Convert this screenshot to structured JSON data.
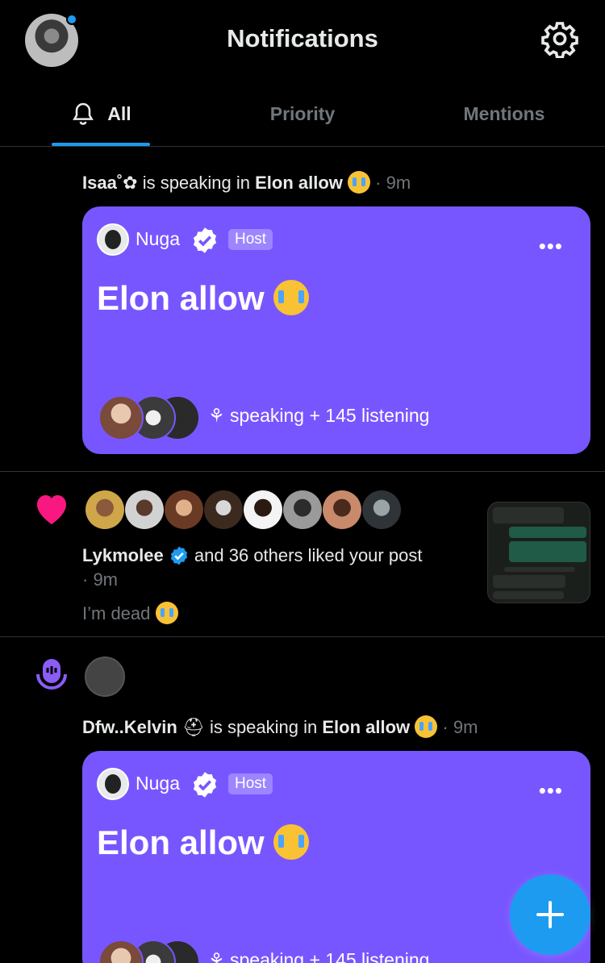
{
  "header": {
    "title": "Notifications",
    "settings_icon": "gear-icon",
    "avatar_has_badge": true
  },
  "tabs": [
    {
      "label": "All",
      "icon": "bell-icon",
      "active": true
    },
    {
      "label": "Priority",
      "active": false
    },
    {
      "label": "Mentions",
      "active": false
    }
  ],
  "notifications": [
    {
      "type": "space",
      "user": "Isaa˚✿",
      "action": " is speaking in ",
      "space_name": "Elon allow",
      "time": "· 9m",
      "card": {
        "host_name": "Nuga",
        "host_badge": "Host",
        "title": "Elon allow",
        "listening": "speaking + 145 listening",
        "more": "•••"
      }
    },
    {
      "type": "like",
      "user": "Lykmolee",
      "action": " and 36 others liked your post",
      "time": "· 9m",
      "post_text": "I’m dead"
    },
    {
      "type": "space",
      "user": "Dfw..Kelvin",
      "action": " is speaking in ",
      "space_name": "Elon allow",
      "time": "· 9m",
      "card": {
        "host_name": "Nuga",
        "host_badge": "Host",
        "title": "Elon allow",
        "listening": "speaking + 145 listening",
        "more": "•••"
      }
    }
  ],
  "colors": {
    "accent": "#1d9bf0",
    "space_purple": "#7856ff",
    "like_pink": "#f91880",
    "background": "#000000"
  }
}
